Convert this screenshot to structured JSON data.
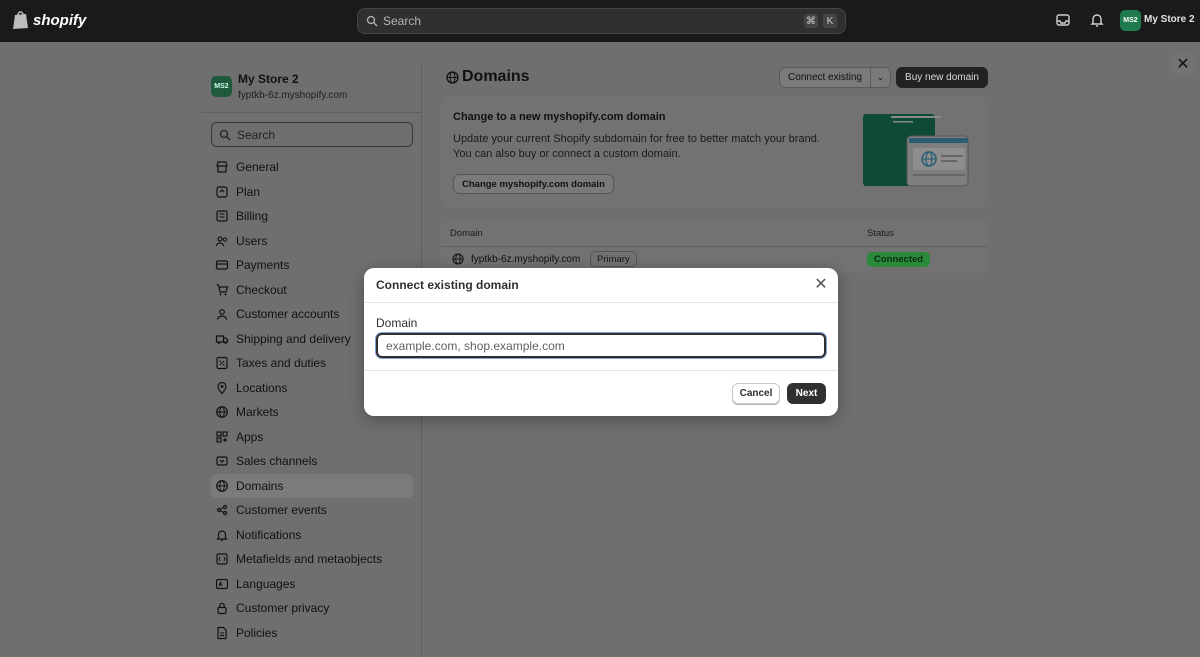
{
  "topbar": {
    "logo_text": "shopify",
    "search_placeholder": "Search",
    "shortcut_keys": [
      "⌘",
      "K"
    ],
    "store_avatar": "MS2",
    "store_name": "My Store 2"
  },
  "sidebar": {
    "store_avatar": "MS2",
    "store_name": "My Store 2",
    "store_domain": "fyptkb-6z.myshopify.com",
    "search_placeholder": "Search",
    "items": [
      {
        "label": "General",
        "icon": "store-icon"
      },
      {
        "label": "Plan",
        "icon": "plan-icon"
      },
      {
        "label": "Billing",
        "icon": "billing-icon"
      },
      {
        "label": "Users",
        "icon": "users-icon"
      },
      {
        "label": "Payments",
        "icon": "payments-icon"
      },
      {
        "label": "Checkout",
        "icon": "cart-icon"
      },
      {
        "label": "Customer accounts",
        "icon": "person-icon"
      },
      {
        "label": "Shipping and delivery",
        "icon": "truck-icon"
      },
      {
        "label": "Taxes and duties",
        "icon": "tax-icon"
      },
      {
        "label": "Locations",
        "icon": "location-icon"
      },
      {
        "label": "Markets",
        "icon": "globe-icon"
      },
      {
        "label": "Apps",
        "icon": "apps-icon"
      },
      {
        "label": "Sales channels",
        "icon": "channels-icon"
      },
      {
        "label": "Domains",
        "icon": "globe-icon",
        "active": true
      },
      {
        "label": "Customer events",
        "icon": "events-icon"
      },
      {
        "label": "Notifications",
        "icon": "bell-icon"
      },
      {
        "label": "Metafields and metaobjects",
        "icon": "metafields-icon"
      },
      {
        "label": "Languages",
        "icon": "language-icon"
      },
      {
        "label": "Customer privacy",
        "icon": "lock-icon"
      },
      {
        "label": "Policies",
        "icon": "document-icon"
      }
    ]
  },
  "main": {
    "page_title": "Domains",
    "connect_existing_label": "Connect existing",
    "buy_new_domain_label": "Buy new domain",
    "promo": {
      "title": "Change to a new myshopify.com domain",
      "description": "Update your current Shopify subdomain for free to better match your brand. You can also buy or connect a custom domain.",
      "button_label": "Change myshopify.com domain"
    },
    "table": {
      "col_domain": "Domain",
      "col_status": "Status",
      "rows": [
        {
          "domain": "fyptkb-6z.myshopify.com",
          "badge": "Primary",
          "status": "Connected"
        }
      ]
    }
  },
  "modal": {
    "title": "Connect existing domain",
    "field_label": "Domain",
    "field_value": "",
    "field_placeholder": "example.com, shop.example.com",
    "cancel_label": "Cancel",
    "next_label": "Next"
  },
  "colors": {
    "topbar_bg": "#1a1a1a",
    "backdrop": "#6f6f6f",
    "status_connected": "#2a8a3a",
    "brand_green": "#1f7a4d",
    "primary_button": "#303030"
  }
}
